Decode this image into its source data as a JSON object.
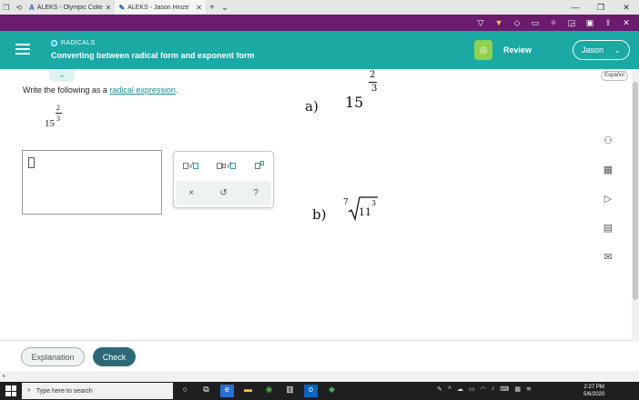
{
  "browser": {
    "tabs": [
      {
        "label": "ALEKS - Olympic College",
        "active": false
      },
      {
        "label": "ALEKS - Jason Hinze",
        "active": true
      }
    ]
  },
  "taskbar": {
    "search_placeholder": "Type here to search",
    "time": "2:27 PM",
    "date": "5/6/2020"
  },
  "header": {
    "topic": "RADICALS",
    "title": "Converting between radical form and exponent form",
    "review_label": "Review",
    "user_name": "Jason"
  },
  "language": "Español",
  "question": {
    "instruction_prefix": "Write the following as a ",
    "instruction_link": "radical expression",
    "instruction_suffix": ".",
    "base": "15",
    "exp_numerator": "2",
    "exp_denominator": "3"
  },
  "palette": {
    "clear_symbol": "×",
    "undo_symbol": "↺",
    "help_symbol": "?"
  },
  "annotations": {
    "a_label": "a)",
    "a_base": "15",
    "a_num": "2",
    "a_den": "3",
    "b_label": "b)",
    "b_index": "7",
    "b_radicand": "11",
    "b_power": "3"
  },
  "footer": {
    "explanation_label": "Explanation",
    "check_label": "Check"
  },
  "colors": {
    "header": "#1aa9a3",
    "ink_toolbar": "#6a1b6e",
    "check_button": "#2d6a77",
    "review_badge": "#8fd14f"
  }
}
